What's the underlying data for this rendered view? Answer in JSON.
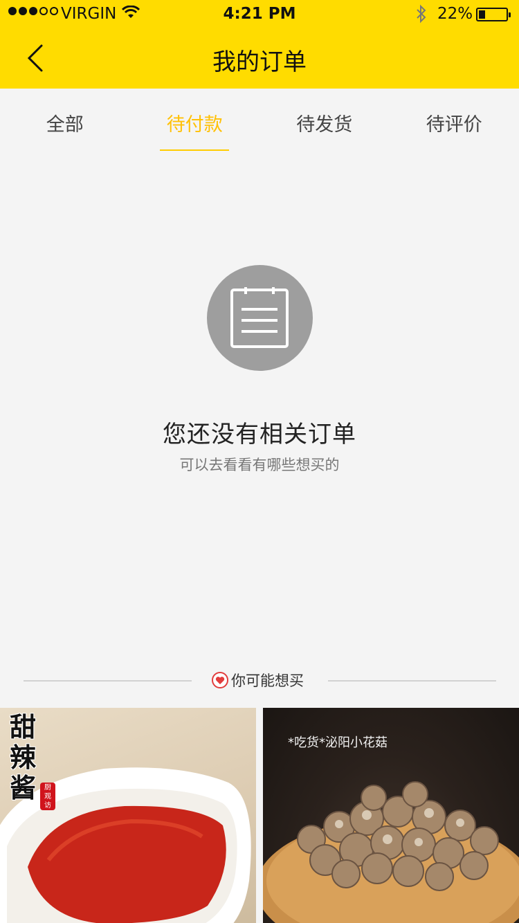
{
  "status_bar": {
    "carrier": "VIRGIN",
    "time": "4:21 PM",
    "battery": "22%",
    "battery_level": 0.22,
    "signal_bars_filled": 3,
    "signal_bars_total": 5
  },
  "nav": {
    "title": "我的订单"
  },
  "tabs": [
    {
      "label": "全部",
      "active": false
    },
    {
      "label": "待付款",
      "active": true
    },
    {
      "label": "待发货",
      "active": false
    },
    {
      "label": "待评价",
      "active": false
    }
  ],
  "empty_state": {
    "icon": "document-icon",
    "title": "您还没有相关订单",
    "subtitle": "可以去看看有哪些想买的"
  },
  "recommend": {
    "label": "你可能想买",
    "icon": "heart-icon"
  },
  "products": [
    {
      "title": "甜辣酱",
      "stamp": "厨观访"
    },
    {
      "title": "*吃货*泌阳小花菇"
    }
  ],
  "colors": {
    "brand_yellow": "#ffdc00",
    "active_tab": "#ffc107",
    "heart_red": "#e23c3c"
  }
}
